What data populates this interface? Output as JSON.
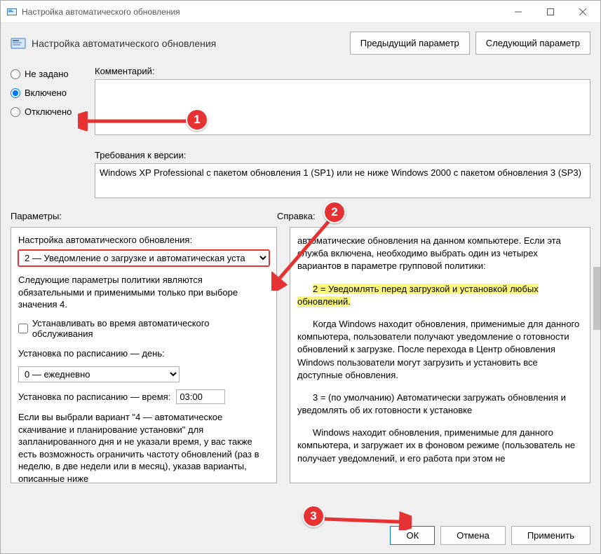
{
  "window": {
    "title": "Настройка автоматического обновления"
  },
  "header": {
    "subtitle": "Настройка автоматического обновления",
    "prev_label": "Предыдущий параметр",
    "next_label": "Следующий параметр"
  },
  "states": {
    "not_configured": "Не задано",
    "enabled": "Включено",
    "disabled": "Отключено",
    "selected": "enabled"
  },
  "comment": {
    "label": "Комментарий:",
    "value": ""
  },
  "requirements": {
    "label": "Требования к версии:",
    "text": "Windows XP Professional с пакетом обновления 1 (SP1) или не ниже Windows 2000 с пакетом обновления 3 (SP3)"
  },
  "labels": {
    "params": "Параметры:",
    "help": "Справка:"
  },
  "params": {
    "heading": "Настройка автоматического обновления:",
    "mode_value": "2 — Уведомление о загрузке и автоматическая уста",
    "policy_note": "Следующие параметры политики являются обязательными и применимыми только при выборе значения 4.",
    "checkbox_label": "Устанавливать во время автоматического обслуживания",
    "checkbox_checked": false,
    "day_label": "Установка по расписанию — день:",
    "day_value": "0 — ежедневно",
    "time_label": "Установка по расписанию — время:",
    "time_value": "03:00",
    "footer_note": "Если вы выбрали вариант \"4 — автоматическое скачивание и планирование установки\" для запланированного дня и не указали время, у вас также есть возможность ограничить частоту обновлений (раз в неделю, в две недели или в месяц), указав варианты, описанные ниже"
  },
  "help": {
    "p1": "автоматические обновления на данном компьютере. Если эта служба включена, необходимо выбрать один из четырех вариантов в параметре групповой политики:",
    "hl": "2 = Уведомлять перед загрузкой и установкой любых обновлений.",
    "p2": "Когда Windows находит обновления, применимые для данного компьютера, пользователи получают уведомление о готовности обновлений к загрузке. После перехода в Центр обновления Windows пользователи могут загрузить и установить все доступные обновления.",
    "p3": "3 = (по умолчанию) Автоматически загружать обновления и уведомлять об их готовности к установке",
    "p4": "Windows находит обновления, применимые для данного компьютера, и загружает их в фоновом режиме (пользователь не получает уведомлений, и его работа при этом не"
  },
  "footer": {
    "ok": "ОК",
    "cancel": "Отмена",
    "apply": "Применить"
  },
  "annotations": {
    "b1": "1",
    "b2": "2",
    "b3": "3"
  }
}
